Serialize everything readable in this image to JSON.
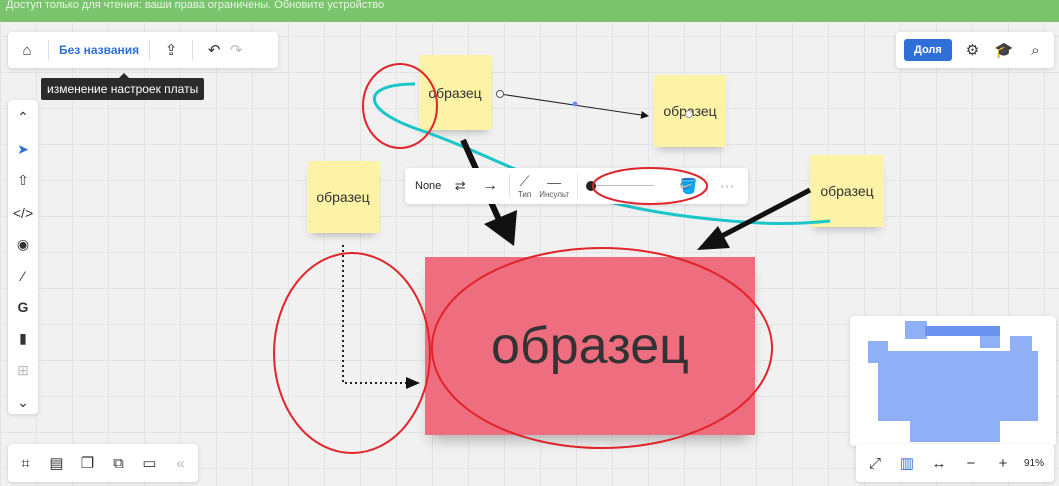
{
  "banner": {
    "text": "Доступ только для чтения: ваши права ограничены. Обновите устройство"
  },
  "topbar": {
    "board_name": "Без названия",
    "tooltip": "изменение настроек платы"
  },
  "share": {
    "label": "Доля"
  },
  "context_bar": {
    "line_start": "None",
    "type_label": "Тип",
    "stroke_label": "Инсульт"
  },
  "stickies": {
    "top_center": "образец",
    "right_top": "образец",
    "left": "образец",
    "right_mid": "образец",
    "big_pink": "образец"
  },
  "zoom": {
    "value": "91%"
  },
  "colors": {
    "accent": "#2f6fd8",
    "sticky_yellow": "#fdf3a6",
    "sticky_pink": "#ee6e80",
    "annotation_red": "#e0242a",
    "connector_cyan": "#1cc6c8",
    "minimap_blue": "#8fb0f7"
  }
}
